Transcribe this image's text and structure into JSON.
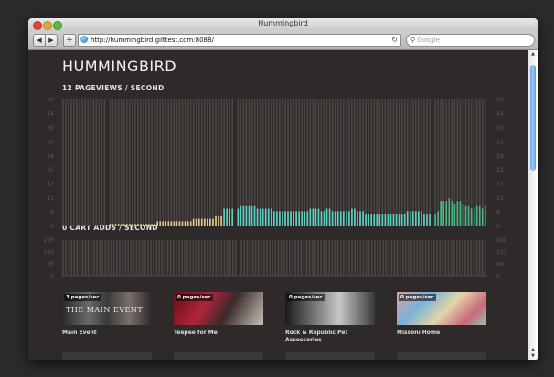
{
  "window": {
    "title": "Hummingbird"
  },
  "toolbar": {
    "back": "◀",
    "forward": "▶",
    "add": "+",
    "url": "http://hummingbird.gilttest.com:8088/",
    "reload": "↻",
    "search_placeholder": "Google",
    "search_icon": "magnifier-icon"
  },
  "page": {
    "logo": "HUMMINGBIRD",
    "pageviews_heading": "12 PAGEVIEWS / SECOND",
    "cartadds_heading": "0 CART ADDS / SECOND"
  },
  "chart_data": [
    {
      "type": "bar",
      "yticks": [
        "50",
        "44",
        "39",
        "33",
        "28",
        "22",
        "17",
        "11",
        "6",
        "0"
      ],
      "ylim": [
        0,
        50
      ],
      "grid": false,
      "colors": {
        "background_bar": "#4a4543",
        "low": "#e8c98a",
        "mid": "#5ed1c2",
        "high": "#4db687"
      },
      "values": [
        0,
        0,
        0,
        0,
        0,
        0,
        0,
        0,
        0,
        0,
        0,
        0,
        0,
        0,
        0,
        0,
        1,
        1,
        1,
        1,
        1,
        1,
        1,
        1,
        1,
        1,
        1,
        1,
        1,
        1,
        1,
        1,
        1,
        1,
        2,
        2,
        2,
        2,
        2,
        2,
        2,
        2,
        2,
        2,
        2,
        2,
        2,
        3,
        3,
        3,
        3,
        3,
        3,
        3,
        3,
        4,
        4,
        4,
        7,
        7,
        7,
        7,
        7,
        7,
        8,
        8,
        8,
        8,
        8,
        8,
        7,
        7,
        7,
        7,
        7,
        7,
        6,
        6,
        6,
        6,
        6,
        6,
        6,
        6,
        6,
        6,
        6,
        6,
        6,
        7,
        7,
        7,
        7,
        6,
        6,
        7,
        7,
        6,
        6,
        6,
        6,
        6,
        6,
        6,
        7,
        7,
        6,
        6,
        6,
        5,
        5,
        5,
        5,
        5,
        5,
        5,
        5,
        5,
        5,
        5,
        5,
        5,
        5,
        5,
        6,
        6,
        6,
        6,
        6,
        6,
        5,
        5,
        5,
        5,
        5,
        6,
        10,
        10,
        10,
        11,
        10,
        9,
        10,
        10,
        9,
        8,
        8,
        7,
        7,
        8,
        8,
        7,
        8
      ],
      "gaps": [
        16,
        62,
        133
      ]
    },
    {
      "type": "bar",
      "yticks": [
        "200",
        "133",
        "66",
        "0"
      ],
      "ylim": [
        0,
        200
      ],
      "grid": false,
      "values": [
        0
      ]
    }
  ],
  "products": [
    {
      "badge": "3 pages/sec",
      "name": "Main Event",
      "image_text": "THE MAIN EVENT"
    },
    {
      "badge": "0 pages/sec",
      "name": "Teepee for Me"
    },
    {
      "badge": "0 pages/sec",
      "name": "Rock & Republic Pet Accessories"
    },
    {
      "badge": "0 pages/sec",
      "name": "Missoni Home"
    }
  ]
}
